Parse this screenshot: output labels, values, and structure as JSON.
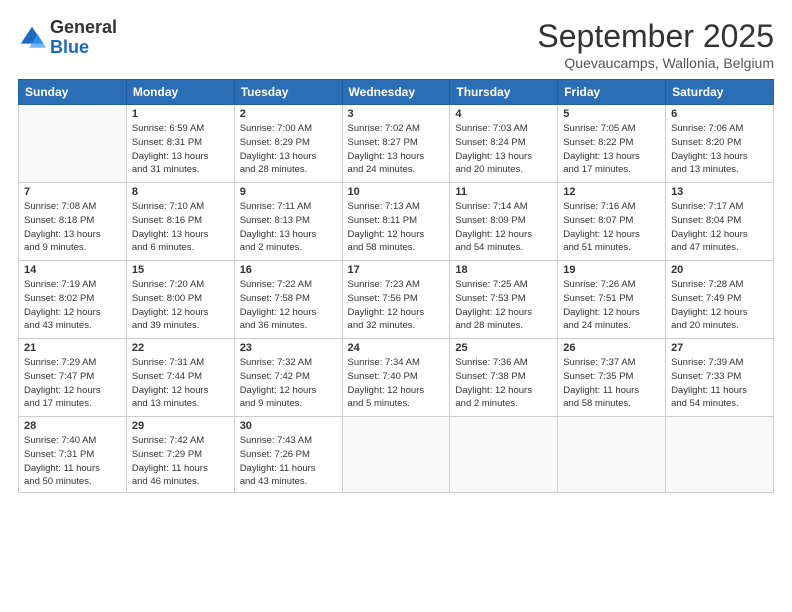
{
  "header": {
    "logo": {
      "line1": "General",
      "line2": "Blue"
    },
    "title": "September 2025",
    "subtitle": "Quevaucamps, Wallonia, Belgium"
  },
  "days_of_week": [
    "Sunday",
    "Monday",
    "Tuesday",
    "Wednesday",
    "Thursday",
    "Friday",
    "Saturday"
  ],
  "weeks": [
    [
      {
        "day": "",
        "info": ""
      },
      {
        "day": "1",
        "info": "Sunrise: 6:59 AM\nSunset: 8:31 PM\nDaylight: 13 hours\nand 31 minutes."
      },
      {
        "day": "2",
        "info": "Sunrise: 7:00 AM\nSunset: 8:29 PM\nDaylight: 13 hours\nand 28 minutes."
      },
      {
        "day": "3",
        "info": "Sunrise: 7:02 AM\nSunset: 8:27 PM\nDaylight: 13 hours\nand 24 minutes."
      },
      {
        "day": "4",
        "info": "Sunrise: 7:03 AM\nSunset: 8:24 PM\nDaylight: 13 hours\nand 20 minutes."
      },
      {
        "day": "5",
        "info": "Sunrise: 7:05 AM\nSunset: 8:22 PM\nDaylight: 13 hours\nand 17 minutes."
      },
      {
        "day": "6",
        "info": "Sunrise: 7:06 AM\nSunset: 8:20 PM\nDaylight: 13 hours\nand 13 minutes."
      }
    ],
    [
      {
        "day": "7",
        "info": "Sunrise: 7:08 AM\nSunset: 8:18 PM\nDaylight: 13 hours\nand 9 minutes."
      },
      {
        "day": "8",
        "info": "Sunrise: 7:10 AM\nSunset: 8:16 PM\nDaylight: 13 hours\nand 6 minutes."
      },
      {
        "day": "9",
        "info": "Sunrise: 7:11 AM\nSunset: 8:13 PM\nDaylight: 13 hours\nand 2 minutes."
      },
      {
        "day": "10",
        "info": "Sunrise: 7:13 AM\nSunset: 8:11 PM\nDaylight: 12 hours\nand 58 minutes."
      },
      {
        "day": "11",
        "info": "Sunrise: 7:14 AM\nSunset: 8:09 PM\nDaylight: 12 hours\nand 54 minutes."
      },
      {
        "day": "12",
        "info": "Sunrise: 7:16 AM\nSunset: 8:07 PM\nDaylight: 12 hours\nand 51 minutes."
      },
      {
        "day": "13",
        "info": "Sunrise: 7:17 AM\nSunset: 8:04 PM\nDaylight: 12 hours\nand 47 minutes."
      }
    ],
    [
      {
        "day": "14",
        "info": "Sunrise: 7:19 AM\nSunset: 8:02 PM\nDaylight: 12 hours\nand 43 minutes."
      },
      {
        "day": "15",
        "info": "Sunrise: 7:20 AM\nSunset: 8:00 PM\nDaylight: 12 hours\nand 39 minutes."
      },
      {
        "day": "16",
        "info": "Sunrise: 7:22 AM\nSunset: 7:58 PM\nDaylight: 12 hours\nand 36 minutes."
      },
      {
        "day": "17",
        "info": "Sunrise: 7:23 AM\nSunset: 7:56 PM\nDaylight: 12 hours\nand 32 minutes."
      },
      {
        "day": "18",
        "info": "Sunrise: 7:25 AM\nSunset: 7:53 PM\nDaylight: 12 hours\nand 28 minutes."
      },
      {
        "day": "19",
        "info": "Sunrise: 7:26 AM\nSunset: 7:51 PM\nDaylight: 12 hours\nand 24 minutes."
      },
      {
        "day": "20",
        "info": "Sunrise: 7:28 AM\nSunset: 7:49 PM\nDaylight: 12 hours\nand 20 minutes."
      }
    ],
    [
      {
        "day": "21",
        "info": "Sunrise: 7:29 AM\nSunset: 7:47 PM\nDaylight: 12 hours\nand 17 minutes."
      },
      {
        "day": "22",
        "info": "Sunrise: 7:31 AM\nSunset: 7:44 PM\nDaylight: 12 hours\nand 13 minutes."
      },
      {
        "day": "23",
        "info": "Sunrise: 7:32 AM\nSunset: 7:42 PM\nDaylight: 12 hours\nand 9 minutes."
      },
      {
        "day": "24",
        "info": "Sunrise: 7:34 AM\nSunset: 7:40 PM\nDaylight: 12 hours\nand 5 minutes."
      },
      {
        "day": "25",
        "info": "Sunrise: 7:36 AM\nSunset: 7:38 PM\nDaylight: 12 hours\nand 2 minutes."
      },
      {
        "day": "26",
        "info": "Sunrise: 7:37 AM\nSunset: 7:35 PM\nDaylight: 11 hours\nand 58 minutes."
      },
      {
        "day": "27",
        "info": "Sunrise: 7:39 AM\nSunset: 7:33 PM\nDaylight: 11 hours\nand 54 minutes."
      }
    ],
    [
      {
        "day": "28",
        "info": "Sunrise: 7:40 AM\nSunset: 7:31 PM\nDaylight: 11 hours\nand 50 minutes."
      },
      {
        "day": "29",
        "info": "Sunrise: 7:42 AM\nSunset: 7:29 PM\nDaylight: 11 hours\nand 46 minutes."
      },
      {
        "day": "30",
        "info": "Sunrise: 7:43 AM\nSunset: 7:26 PM\nDaylight: 11 hours\nand 43 minutes."
      },
      {
        "day": "",
        "info": ""
      },
      {
        "day": "",
        "info": ""
      },
      {
        "day": "",
        "info": ""
      },
      {
        "day": "",
        "info": ""
      }
    ]
  ]
}
